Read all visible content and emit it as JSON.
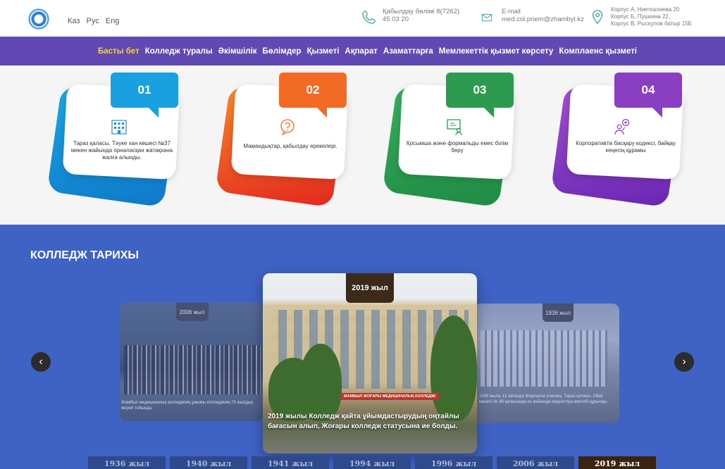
{
  "header": {
    "langs": [
      "Каз",
      "Рус",
      "Eng"
    ],
    "phone_label": "Қабылдау бөлімі 8(7262)",
    "phone_number": "45 03 20",
    "email_label": "E-mail",
    "email_value": "med.col.priem@zhambyl.kz",
    "address": [
      "Корпус А, Ниеткалиева 20",
      "Корпус Б, Пушкина 22,",
      "Корпус В, Рыскулов батыр 15Б"
    ]
  },
  "nav": {
    "items": [
      "Басты бет",
      "Колледж туралы",
      "Әкімшілік",
      "Бөлімдер",
      "Қызметі",
      "Ақпарат",
      "Азаматтарға",
      "Мемлекеттік қызмет көрсету",
      "Комплаенс қызметі"
    ],
    "active_index": 0
  },
  "cards": [
    {
      "num": "01",
      "text": "Тараз қаласы, Тәуке хан көшесі №37 мекен жайында орналасқан жатақхана жалға алынды.",
      "icon": "building-icon",
      "color": "#18a0e0"
    },
    {
      "num": "02",
      "text": "Мамандықтар, қабылдау ерекелері.",
      "icon": "question-bubble-icon",
      "color": "#f26a23"
    },
    {
      "num": "03",
      "text": "Қосымша және формальды емес білім беру",
      "icon": "presentation-board-icon",
      "color": "#2c9b50"
    },
    {
      "num": "04",
      "text": "Корпоративтік басқару кодексі, байқау кеңесің құрамы",
      "icon": "team-idea-icon",
      "color": "#8a3fc2"
    }
  ],
  "history": {
    "title": "КОЛЛЕДЖ ТАРИХЫ",
    "prev_slide": {
      "year": "2006 жыл",
      "caption": "Жамбыл медициналық колледжінің ұжымы колледжінің 70 жылдық мерей тойында."
    },
    "current_slide": {
      "year": "2019 жыл",
      "caption": "2019 жылы Колледж қайта ұйымдастырудың оңтайлы бағасын алып, Жоғары колледж статусына ие болды.",
      "sign": "ЖАМБЫЛ ЖОҒАРЫ МЕДИЦИНАЛЫҚ КОЛЛЕДЖІ"
    },
    "next_slide": {
      "year": "1936 жыл",
      "caption": "1936 жылы 12 акпанда Медицина училищ. Тараз қаласы, Абай көшесі № 98 қаласында өз жайында медсестра мектебі құрылды."
    },
    "timeline": [
      "1936 жыл",
      "1940 жыл",
      "1941 жыл",
      "1994 жыл",
      "1996 жыл",
      "2006 жыл",
      "2019 жыл"
    ],
    "selected_index": 6
  }
}
